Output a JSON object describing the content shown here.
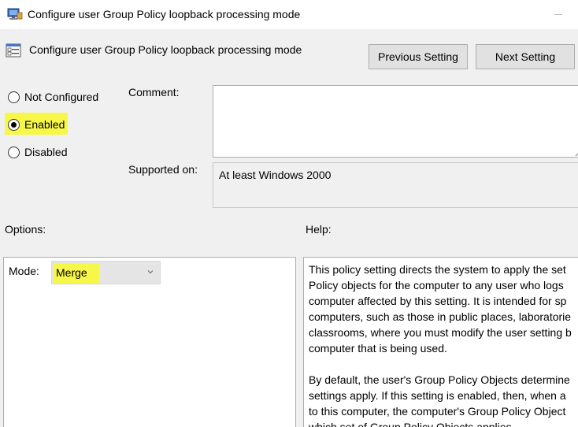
{
  "window": {
    "title": "Configure user Group Policy loopback processing mode"
  },
  "header": {
    "title": "Configure user Group Policy loopback processing mode",
    "prev_label": "Previous Setting",
    "next_label": "Next Setting"
  },
  "state": {
    "options": [
      {
        "label": "Not Configured",
        "selected": false
      },
      {
        "label": "Enabled",
        "selected": true
      },
      {
        "label": "Disabled",
        "selected": false
      }
    ]
  },
  "comment": {
    "label": "Comment:",
    "value": ""
  },
  "supported": {
    "label": "Supported on:",
    "value": "At least Windows 2000"
  },
  "options_section": {
    "label": "Options:",
    "mode_label": "Mode:",
    "mode_value": "Merge"
  },
  "help_section": {
    "label": "Help:",
    "paragraph1": "This policy setting directs the system to apply the set\nPolicy objects for the computer to any user who logs\ncomputer affected by this setting. It is intended for sp\ncomputers, such as those in public places, laboratorie\nclassrooms, where you must modify the user setting b\ncomputer that is being used.",
    "paragraph2": "By default, the user's Group Policy Objects determine\nsettings apply. If this setting is enabled, then, when a\nto this computer, the computer's Group Policy Object\nwhich set of Group Policy Objects applies."
  },
  "colors": {
    "highlight": "#f7f74a",
    "window_bg": "#f0f0f0",
    "button_bg": "#e1e1e1"
  },
  "icons": {
    "app": "group-policy-icon",
    "header": "policy-setting-icon",
    "dropdown": "chevron-down-icon"
  }
}
